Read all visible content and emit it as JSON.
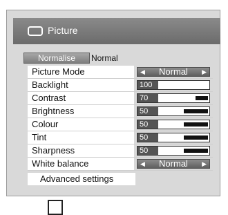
{
  "window": {
    "title": "Picture",
    "icon": "screen-icon"
  },
  "normalise": {
    "button_label": "Normalise",
    "state": "Normal"
  },
  "rows": [
    {
      "label": "Picture Mode",
      "type": "selector",
      "value": "Normal"
    },
    {
      "label": "Backlight",
      "type": "level",
      "value": "100",
      "fraction": 0.0
    },
    {
      "label": "Contrast",
      "type": "level",
      "value": "70",
      "fraction": 0.25
    },
    {
      "label": "Brightness",
      "type": "level",
      "value": "50",
      "fraction": 0.5
    },
    {
      "label": "Colour",
      "type": "level",
      "value": "50",
      "fraction": 0.5
    },
    {
      "label": "Tint",
      "type": "level",
      "value": "50",
      "fraction": 0.5
    },
    {
      "label": "Sharpness",
      "type": "level",
      "value": "50",
      "fraction": 0.5
    },
    {
      "label": "White balance",
      "type": "selector",
      "value": "Normal"
    }
  ],
  "advanced": {
    "label": "Advanced settings"
  }
}
